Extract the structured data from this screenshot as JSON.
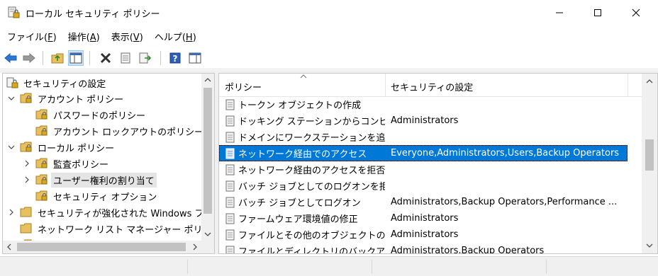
{
  "window": {
    "title": "ローカル セキュリティ ポリシー"
  },
  "menu": [
    {
      "label": "ファイル",
      "key": "F"
    },
    {
      "label": "操作",
      "key": "A"
    },
    {
      "label": "表示",
      "key": "V"
    },
    {
      "label": "ヘルプ",
      "key": "H"
    }
  ],
  "tree": {
    "root": "セキュリティの設定",
    "account_policies": "アカウント ポリシー",
    "password_policy": "パスワードのポリシー",
    "lockout_policy": "アカウント ロックアウトのポリシー",
    "local_policies": "ローカル ポリシー",
    "audit_policy": "監査ポリシー",
    "user_rights": "ユーザー権利の割り当て",
    "security_options": "セキュリティ オプション",
    "windows_firewall": "セキュリティが強化された Windows ファ",
    "network_list": "ネットワーク リスト マネージャー ポリシー",
    "partial_next": "公開キーのポリシー"
  },
  "list": {
    "col_policy": "ポリシー",
    "col_setting": "セキュリティの設定",
    "rows": [
      {
        "policy": "トークン オブジェクトの作成",
        "setting": ""
      },
      {
        "policy": "ドッキング ステーションからコンピュ...",
        "setting": "Administrators"
      },
      {
        "policy": "ドメインにワークステーションを追加",
        "setting": ""
      },
      {
        "policy": "ネットワーク経由でのアクセス",
        "setting": "Everyone,Administrators,Users,Backup Operators"
      },
      {
        "policy": "ネットワーク経由のアクセスを拒否",
        "setting": ""
      },
      {
        "policy": "バッチ ジョブとしてのログオンを拒否",
        "setting": ""
      },
      {
        "policy": "バッチ ジョブとしてログオン",
        "setting": "Administrators,Backup Operators,Performance ..."
      },
      {
        "policy": "ファームウェア環境値の修正",
        "setting": "Administrators"
      },
      {
        "policy": "ファイルとその他のオブジェクトの...",
        "setting": "Administrators"
      },
      {
        "policy": "ファイルとディレクトリのバックアップ",
        "setting": "Administrators,Backup Operators"
      }
    ],
    "selected_index": 3
  },
  "colors": {
    "selection": "#0078d7",
    "folder": "#e8c060"
  }
}
